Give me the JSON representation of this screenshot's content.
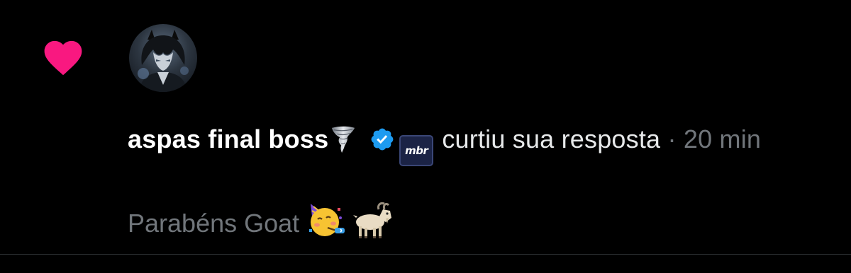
{
  "notification": {
    "type_icon": "heart-icon",
    "avatar": "avatar",
    "user": {
      "display_name": "aspas final boss",
      "name_emoji": "tornado-icon",
      "verified_icon": "verified-badge-icon",
      "affiliate_badge_text": "mbr"
    },
    "action_text": "curtiu sua resposta",
    "separator": "·",
    "time": "20 min",
    "reply_text": "Parabéns Goat",
    "reply_emojis": [
      "partying-face-icon",
      "goat-icon"
    ]
  },
  "colors": {
    "background": "#000000",
    "heart": "#f91880",
    "verified": "#1d9bf0",
    "primary_text": "#e7e9ea",
    "secondary_text": "#71767b",
    "divider": "#2f3336"
  }
}
